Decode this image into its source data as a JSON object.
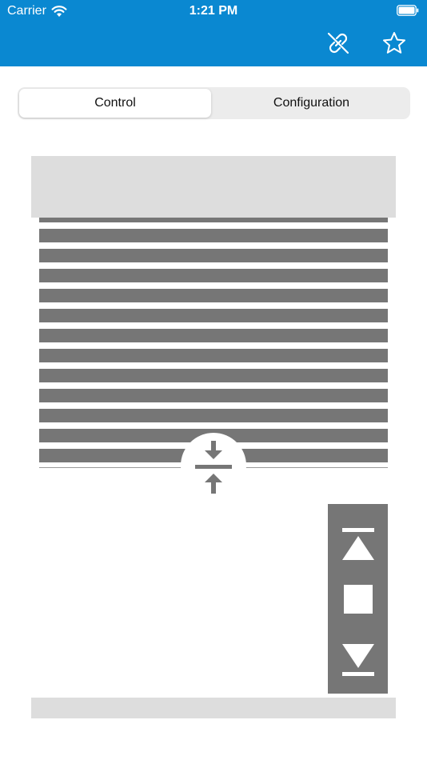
{
  "status_bar": {
    "carrier": "Carrier",
    "time": "1:21 PM"
  },
  "toolbar": {
    "icons": [
      "unlink-icon",
      "star-icon"
    ]
  },
  "tabs": [
    {
      "label": "Control",
      "selected": true
    },
    {
      "label": "Configuration",
      "selected": false
    }
  ],
  "shade": {
    "slat_count": 13
  },
  "controls": [
    "move-up-icon",
    "stop-icon",
    "move-down-icon"
  ],
  "colors": {
    "brand": "#0a88d1",
    "slat": "#767676",
    "panel": "#767676",
    "box": "#dddddd"
  }
}
